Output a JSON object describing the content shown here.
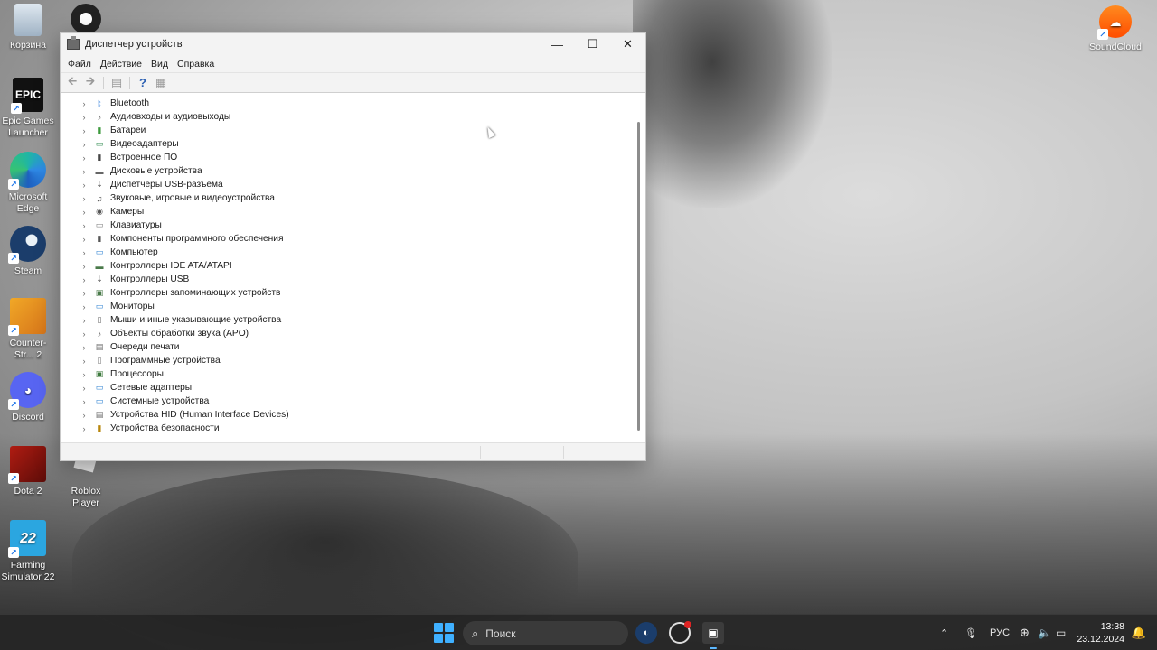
{
  "desktop": {
    "icons_left": [
      {
        "label": "Корзина",
        "icon": "recycle-bin-icon"
      },
      {
        "label": "Epic Games Launcher",
        "icon": "epic-games-icon",
        "logo_text": "EPIC"
      },
      {
        "label": "Microsoft Edge",
        "icon": "edge-icon"
      },
      {
        "label": "Steam",
        "icon": "steam-icon"
      },
      {
        "label": "Counter-Str... 2",
        "icon": "counter-strike-icon"
      },
      {
        "label": "Discord",
        "icon": "discord-icon"
      },
      {
        "label": "Dota 2",
        "icon": "dota-icon"
      },
      {
        "label": "Farming Simulator 22",
        "icon": "farming-simulator-icon",
        "logo_text": "22"
      }
    ],
    "icon_obs": {
      "label": "",
      "icon": "obs-icon"
    },
    "icon_roblox": {
      "label": "Roblox Player",
      "icon": "roblox-icon"
    },
    "icon_soundcloud": {
      "label": "SoundCloud",
      "icon": "soundcloud-icon"
    }
  },
  "window": {
    "title": "Диспетчер устройств",
    "controls": {
      "minimize": "—",
      "maximize": "☐",
      "close": "✕"
    },
    "menu": [
      "Файл",
      "Действие",
      "Вид",
      "Справка"
    ],
    "toolbar": {
      "back": "🡰",
      "forward": "🡲",
      "properties": "▤",
      "help": "?",
      "view": "▦"
    },
    "tree": [
      {
        "label": "Bluetooth",
        "icon": "bluetooth-icon",
        "glyph": "ᛒ",
        "color": "#1e73d8"
      },
      {
        "label": "Аудиовходы и аудиовыходы",
        "icon": "audio-io-icon",
        "glyph": "♪",
        "color": "#555555"
      },
      {
        "label": "Батареи",
        "icon": "battery-icon",
        "glyph": "▮",
        "color": "#3d9a3d"
      },
      {
        "label": "Видеоадаптеры",
        "icon": "display-adapter-icon",
        "glyph": "▭",
        "color": "#2e8a4e"
      },
      {
        "label": "Встроенное ПО",
        "icon": "firmware-icon",
        "glyph": "▮",
        "color": "#444444"
      },
      {
        "label": "Дисковые устройства",
        "icon": "disk-drive-icon",
        "glyph": "▬",
        "color": "#666666"
      },
      {
        "label": "Диспетчеры USB-разъема",
        "icon": "usb-connector-icon",
        "glyph": "⇣",
        "color": "#555555"
      },
      {
        "label": "Звуковые, игровые и видеоустройства",
        "icon": "sound-icon",
        "glyph": "♫",
        "color": "#555555"
      },
      {
        "label": "Камеры",
        "icon": "camera-icon",
        "glyph": "◉",
        "color": "#555555"
      },
      {
        "label": "Клавиатуры",
        "icon": "keyboard-icon",
        "glyph": "▭",
        "color": "#777777"
      },
      {
        "label": "Компоненты программного обеспечения",
        "icon": "software-component-icon",
        "glyph": "▮",
        "color": "#555555"
      },
      {
        "label": "Компьютер",
        "icon": "computer-icon",
        "glyph": "▭",
        "color": "#2a7fd0"
      },
      {
        "label": "Контроллеры IDE ATA/ATAPI",
        "icon": "ide-controller-icon",
        "glyph": "▬",
        "color": "#4a7a4a"
      },
      {
        "label": "Контроллеры USB",
        "icon": "usb-controller-icon",
        "glyph": "⇣",
        "color": "#555555"
      },
      {
        "label": "Контроллеры запоминающих устройств",
        "icon": "storage-controller-icon",
        "glyph": "▣",
        "color": "#4a7a4a"
      },
      {
        "label": "Мониторы",
        "icon": "monitor-icon",
        "glyph": "▭",
        "color": "#2a7fd0"
      },
      {
        "label": "Мыши и иные указывающие устройства",
        "icon": "mouse-icon",
        "glyph": "▯",
        "color": "#666666"
      },
      {
        "label": "Объекты обработки звука (APO)",
        "icon": "apo-icon",
        "glyph": "♪",
        "color": "#555555"
      },
      {
        "label": "Очереди печати",
        "icon": "print-queue-icon",
        "glyph": "▤",
        "color": "#666666"
      },
      {
        "label": "Программные устройства",
        "icon": "software-device-icon",
        "glyph": "▯",
        "color": "#777777"
      },
      {
        "label": "Процессоры",
        "icon": "processor-icon",
        "glyph": "▣",
        "color": "#3d7a3d"
      },
      {
        "label": "Сетевые адаптеры",
        "icon": "network-adapter-icon",
        "glyph": "▭",
        "color": "#2a7fd0"
      },
      {
        "label": "Системные устройства",
        "icon": "system-device-icon",
        "glyph": "▭",
        "color": "#2a7fd0"
      },
      {
        "label": "Устройства HID (Human Interface Devices)",
        "icon": "hid-icon",
        "glyph": "▤",
        "color": "#666666"
      },
      {
        "label": "Устройства безопасности",
        "icon": "security-device-icon",
        "glyph": "▮",
        "color": "#b8860b"
      }
    ]
  },
  "taskbar": {
    "search_placeholder": "Поиск",
    "tray": {
      "language": "РУС",
      "time": "13:38",
      "date": "23.12.2024"
    }
  }
}
